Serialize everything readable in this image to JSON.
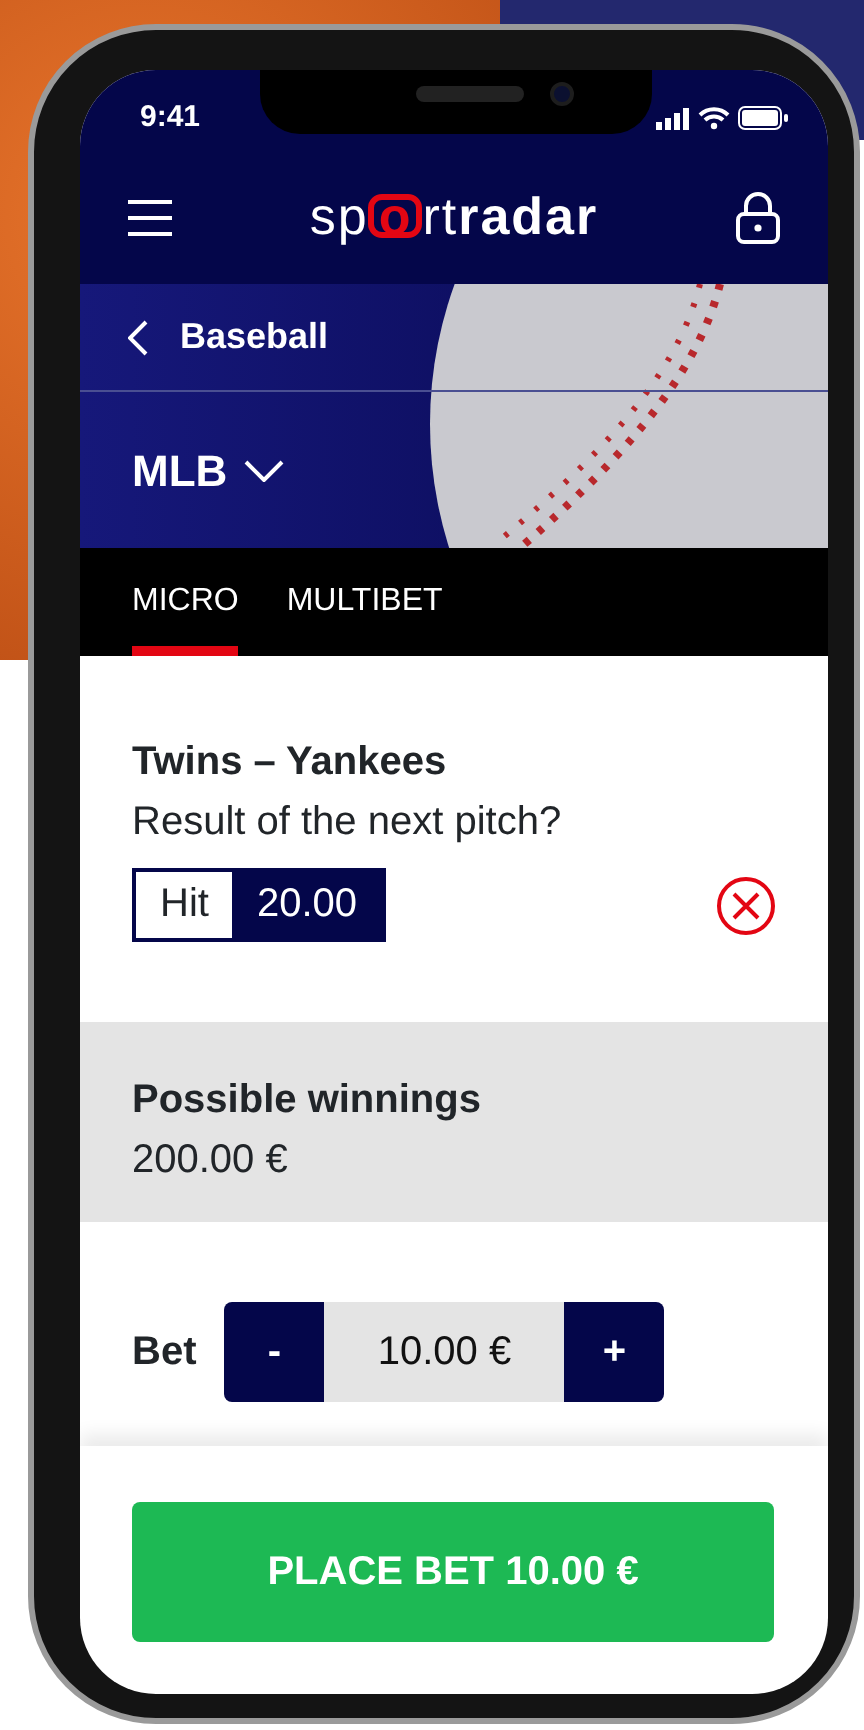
{
  "status_bar": {
    "time": "9:41"
  },
  "header": {
    "logo": {
      "prefix": "sp",
      "mark": "o",
      "suffix": "rt",
      "bold": "radar"
    }
  },
  "banner": {
    "back_label": "Baseball",
    "league": "MLB"
  },
  "tabs": [
    {
      "label": "MICRO",
      "selected": true
    },
    {
      "label": "MULTIBET",
      "selected": false
    }
  ],
  "selection": {
    "match": "Twins – Yankees",
    "question": "Result of the next pitch?",
    "pick": "Hit",
    "odds": "20.00"
  },
  "winnings": {
    "label": "Possible winnings",
    "amount": "200.00 €"
  },
  "bet": {
    "label": "Bet",
    "minus": "-",
    "amount": "10.00 €",
    "plus": "+"
  },
  "place_button": "PLACE BET 10.00 €"
}
